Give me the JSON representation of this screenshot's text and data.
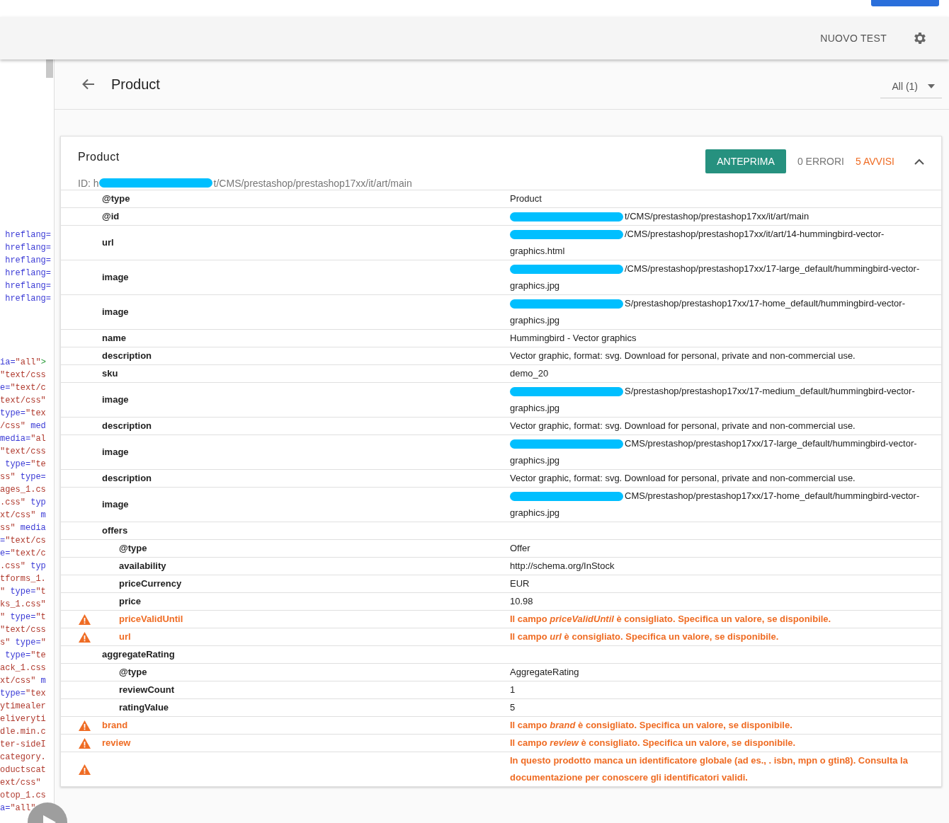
{
  "toolbar": {
    "action": "NUOVO TEST"
  },
  "source_code": {
    "block_1": [
      [
        {
          "kind": "attr",
          "text": " hreflang="
        }
      ],
      [
        {
          "kind": "attr",
          "text": " hreflang="
        }
      ],
      [
        {
          "kind": "attr",
          "text": " hreflang="
        }
      ],
      [
        {
          "kind": "attr",
          "text": " hreflang="
        }
      ],
      [
        {
          "kind": "attr",
          "text": " hreflang="
        }
      ],
      [
        {
          "kind": "attr",
          "text": " hreflang="
        }
      ]
    ],
    "block_2": [
      [
        {
          "kind": "attr",
          "text": "ia="
        },
        {
          "kind": "string",
          "text": "\"all\""
        },
        {
          "kind": "tag",
          "text": ">"
        }
      ],
      [
        {
          "kind": "string",
          "text": "\"text/css"
        }
      ],
      [
        {
          "kind": "attr",
          "text": "e="
        },
        {
          "kind": "string",
          "text": "\"text/c"
        }
      ],
      [
        {
          "kind": "string",
          "text": "text/css\""
        }
      ],
      [
        {
          "kind": "attr",
          "text": "type="
        },
        {
          "kind": "string",
          "text": "\"tex"
        }
      ],
      [
        {
          "kind": "string",
          "text": "/css\""
        },
        {
          "kind": "attr",
          "text": " med"
        }
      ],
      [
        {
          "kind": "attr",
          "text": "media="
        },
        {
          "kind": "string",
          "text": "\"al"
        }
      ],
      [
        {
          "kind": "string",
          "text": "\"text/css"
        }
      ],
      [
        {
          "kind": "attr",
          "text": " type="
        },
        {
          "kind": "string",
          "text": "\"te"
        }
      ],
      [
        {
          "kind": "string",
          "text": "ss\""
        },
        {
          "kind": "attr",
          "text": " type="
        }
      ],
      [
        {
          "kind": "string",
          "text": "ages_1.cs"
        }
      ],
      [
        {
          "kind": "string",
          "text": ".css\""
        },
        {
          "kind": "attr",
          "text": " typ"
        }
      ],
      [
        {
          "kind": "string",
          "text": "xt/css\""
        },
        {
          "kind": "attr",
          "text": " m"
        }
      ],
      [
        {
          "kind": "string",
          "text": "ss\""
        },
        {
          "kind": "attr",
          "text": " media"
        }
      ],
      [
        {
          "kind": "attr",
          "text": "="
        },
        {
          "kind": "string",
          "text": "\"text/cs"
        }
      ],
      [
        {
          "kind": "attr",
          "text": "e="
        },
        {
          "kind": "string",
          "text": "\"text/c"
        }
      ],
      [
        {
          "kind": "string",
          "text": ".css\""
        },
        {
          "kind": "attr",
          "text": " typ"
        }
      ],
      [
        {
          "kind": "string",
          "text": "tforms_1."
        }
      ],
      [
        {
          "kind": "string",
          "text": "\""
        },
        {
          "kind": "attr",
          "text": " type="
        },
        {
          "kind": "string",
          "text": "\"t"
        }
      ],
      [
        {
          "kind": "string",
          "text": "ks_1.css\""
        }
      ],
      [
        {
          "kind": "string",
          "text": "\""
        },
        {
          "kind": "attr",
          "text": " type="
        },
        {
          "kind": "string",
          "text": "\"t"
        }
      ],
      [
        {
          "kind": "string",
          "text": "\"text/css"
        }
      ],
      [
        {
          "kind": "string",
          "text": "s\""
        },
        {
          "kind": "attr",
          "text": " type="
        },
        {
          "kind": "string",
          "text": "\""
        }
      ],
      [
        {
          "kind": "attr",
          "text": " type="
        },
        {
          "kind": "string",
          "text": "\"te"
        }
      ],
      [
        {
          "kind": "string",
          "text": "ack_1.css"
        }
      ],
      [
        {
          "kind": "string",
          "text": "xt/css\""
        },
        {
          "kind": "attr",
          "text": " m"
        }
      ],
      [
        {
          "kind": "attr",
          "text": "type="
        },
        {
          "kind": "string",
          "text": "\"tex"
        }
      ],
      [
        {
          "kind": "string",
          "text": "ytimealer"
        }
      ],
      [
        {
          "kind": "string",
          "text": "eliveryti"
        }
      ],
      [
        {
          "kind": "string",
          "text": "dle.min.c"
        }
      ],
      [
        {
          "kind": "string",
          "text": "ter-sideI"
        }
      ],
      [
        {
          "kind": "string",
          "text": "category."
        }
      ],
      [
        {
          "kind": "string",
          "text": "oductscat"
        }
      ],
      [
        {
          "kind": "string",
          "text": "ext/css\""
        }
      ],
      [
        {
          "kind": "string",
          "text": "otop_1.cs"
        }
      ],
      [
        {
          "kind": "attr",
          "text": "a="
        },
        {
          "kind": "string",
          "text": "\"all\""
        }
      ]
    ]
  },
  "page_header": {
    "title": "Product",
    "filter": "All (1)"
  },
  "card": {
    "title": "Product",
    "id_prefix": "ID: h",
    "id_suffix": "t/CMS/prestashop/prestashop17xx/it/art/main",
    "preview_button": "ANTEPRIMA",
    "errors": "0 ERRORI",
    "warnings": "5 AVVISI",
    "expanded": true,
    "rows": [
      {
        "key": "@type",
        "value": "Product",
        "warning": false
      },
      {
        "key": "@id",
        "value": "t/CMS/prestashop/prestashop17xx/it/art/main",
        "redacted": true,
        "warning": false
      },
      {
        "key": "url",
        "value": "/CMS/prestashop/prestashop17xx/it/art/14-hummingbird-vector-graphics.html",
        "redacted": true,
        "warning": false
      },
      {
        "key": "image",
        "value": "/CMS/prestashop/prestashop17xx/17-large_default/hummingbird-vector-graphics.jpg",
        "redacted": true,
        "warning": false
      },
      {
        "key": "image",
        "value": "S/prestashop/prestashop17xx/17-home_default/hummingbird-vector-graphics.jpg",
        "redacted": true,
        "warning": false
      },
      {
        "key": "name",
        "value": "Hummingbird - Vector graphics",
        "warning": false
      },
      {
        "key": "description",
        "value": "Vector graphic, format: svg. Download for personal, private and non-commercial use.",
        "warning": false
      },
      {
        "key": "sku",
        "value": "demo_20",
        "warning": false
      },
      {
        "key": "image",
        "value": "S/prestashop/prestashop17xx/17-medium_default/hummingbird-vector-graphics.jpg",
        "redacted": true,
        "warning": false
      },
      {
        "key": "description",
        "value": "Vector graphic, format: svg. Download for personal, private and non-commercial use.",
        "warning": false
      },
      {
        "key": "image",
        "value": "CMS/prestashop/prestashop17xx/17-large_default/hummingbird-vector-graphics.jpg",
        "redacted": true,
        "warning": false
      },
      {
        "key": "description",
        "value": "Vector graphic, format: svg. Download for personal, private and non-commercial use.",
        "warning": false
      },
      {
        "key": "image",
        "value": "CMS/prestashop/prestashop17xx/17-home_default/hummingbird-vector-graphics.jpg",
        "redacted": true,
        "warning": false
      },
      {
        "key": "offers",
        "warning": false,
        "children": [
          {
            "key": "@type",
            "value": "Offer",
            "warning": false
          },
          {
            "key": "availability",
            "value": "http://schema.org/InStock",
            "warning": false
          },
          {
            "key": "priceCurrency",
            "value": "EUR",
            "warning": false
          },
          {
            "key": "price",
            "value": "10.98",
            "warning": false
          },
          {
            "key": "priceValidUntil",
            "value": "Il campo *priceValidUntil* è consigliato. Specifica un valore, se disponibile.",
            "warning": true
          },
          {
            "key": "url",
            "value": "Il campo *url* è consigliato. Specifica un valore, se disponibile.",
            "warning": true
          }
        ]
      },
      {
        "key": "aggregateRating",
        "warning": false,
        "children": [
          {
            "key": "@type",
            "value": "AggregateRating",
            "warning": false
          },
          {
            "key": "reviewCount",
            "value": "1",
            "warning": false
          },
          {
            "key": "ratingValue",
            "value": "5",
            "warning": false
          }
        ]
      },
      {
        "key": "brand",
        "value": "Il campo *brand* è consigliato. Specifica un valore, se disponibile.",
        "warning": true
      },
      {
        "key": "review",
        "value": "Il campo *review* è consigliato. Specifica un valore, se disponibile.",
        "warning": true
      },
      {
        "value": "In questo prodotto manca un identificatore globale (ad es., . isbn, mpn o gtin8). Consulta la documentazione per conoscere gli identificatori validi.",
        "warning": true
      }
    ]
  }
}
